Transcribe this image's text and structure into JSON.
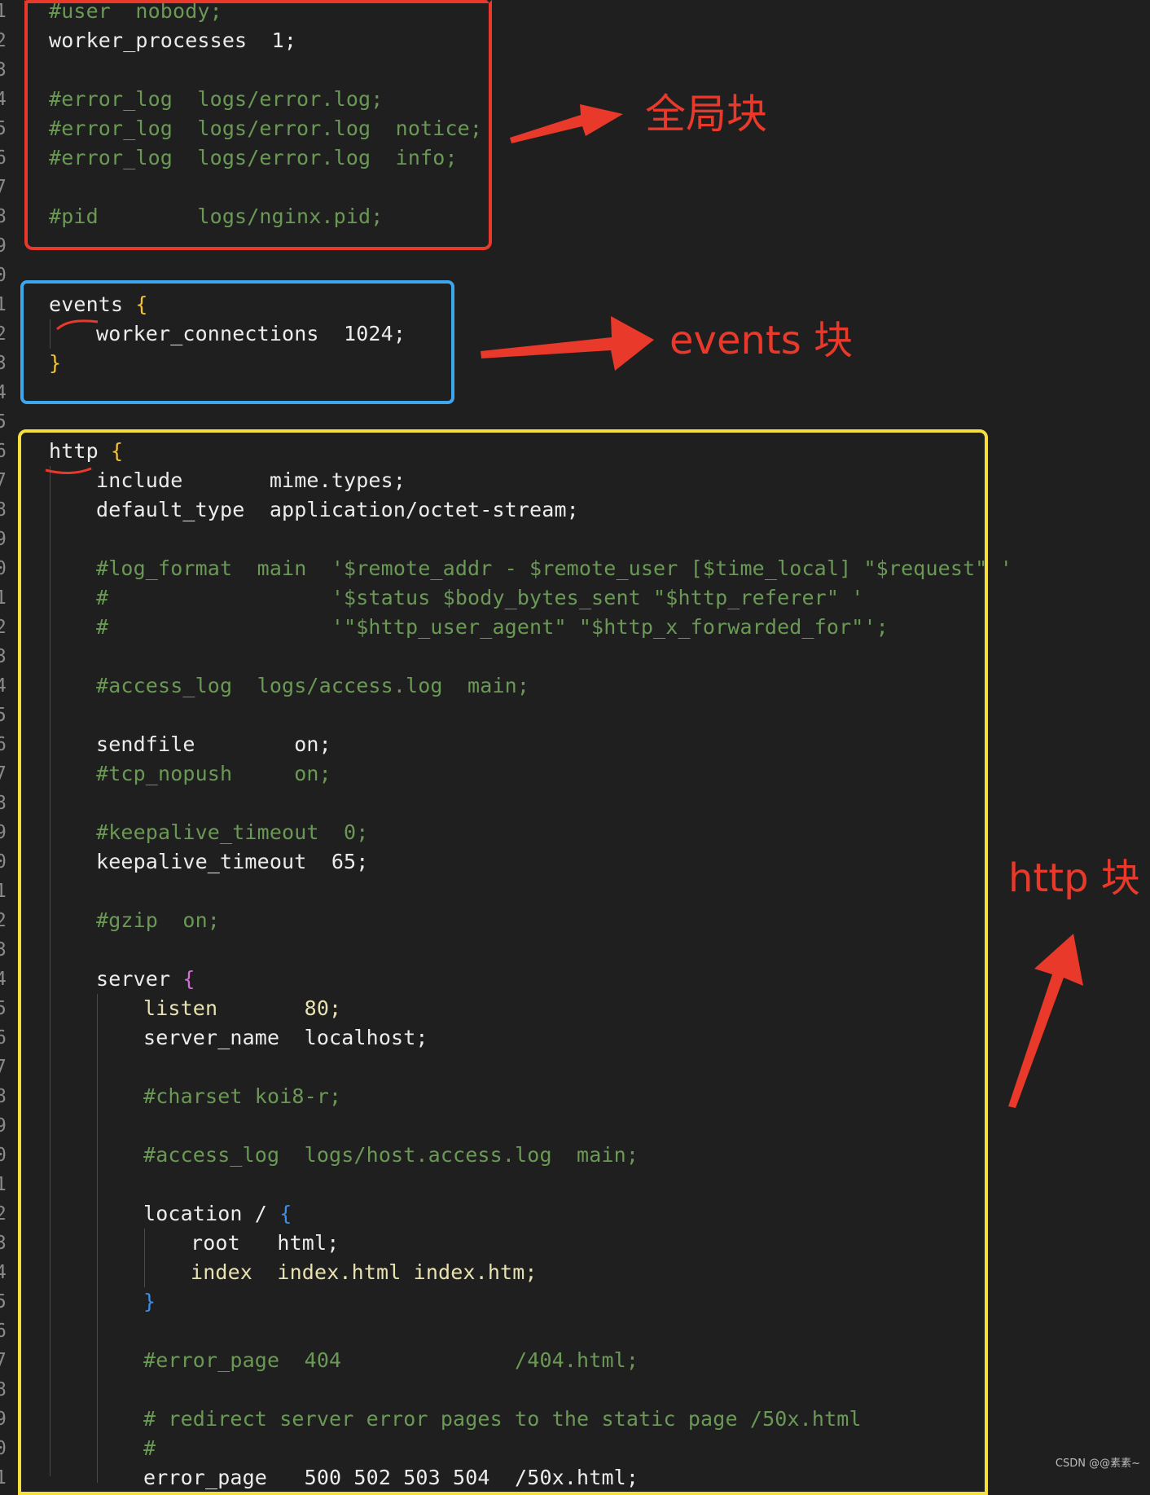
{
  "code_lines": [
    {
      "ln": "1",
      "text": "#user  nobody;",
      "style": "comment",
      "indent": 0
    },
    {
      "ln": "2",
      "text": "worker_processes  1;",
      "style": "plain",
      "indent": 0
    },
    {
      "ln": "3",
      "text": "",
      "style": "plain",
      "indent": 0
    },
    {
      "ln": "4",
      "text": "#error_log  logs/error.log;",
      "style": "comment",
      "indent": 0
    },
    {
      "ln": "5",
      "text": "#error_log  logs/error.log  notice;",
      "style": "comment",
      "indent": 0
    },
    {
      "ln": "6",
      "text": "#error_log  logs/error.log  info;",
      "style": "comment",
      "indent": 0
    },
    {
      "ln": "7",
      "text": "",
      "style": "plain",
      "indent": 0
    },
    {
      "ln": "8",
      "text": "#pid        logs/nginx.pid;",
      "style": "comment",
      "indent": 0
    },
    {
      "ln": "9",
      "text": "",
      "style": "plain",
      "indent": 0
    },
    {
      "ln": "0",
      "text": "",
      "style": "plain",
      "indent": 0
    },
    {
      "ln": "1",
      "text": "events ",
      "style": "plain",
      "indent": 0,
      "brace": "{",
      "brace_style": "brace-gold"
    },
    {
      "ln": "2",
      "text": "worker_connections  1024;",
      "style": "plain",
      "indent": 1
    },
    {
      "ln": "3",
      "text": "",
      "style": "plain",
      "indent": 0,
      "brace": "}",
      "brace_style": "brace-gold"
    },
    {
      "ln": "4",
      "text": "",
      "style": "plain",
      "indent": 0
    },
    {
      "ln": "5",
      "text": "",
      "style": "plain",
      "indent": 0
    },
    {
      "ln": "6",
      "text": "http ",
      "style": "plain",
      "indent": 0,
      "brace": "{",
      "brace_style": "brace-gold"
    },
    {
      "ln": "7",
      "text": "include       mime.types;",
      "style": "plain",
      "indent": 1
    },
    {
      "ln": "8",
      "text": "default_type  application/octet-stream;",
      "style": "plain",
      "indent": 1
    },
    {
      "ln": "9",
      "text": "",
      "style": "plain",
      "indent": 0
    },
    {
      "ln": "0",
      "text": "#log_format  main  '$remote_addr - $remote_user [$time_local] \"$request\" '",
      "style": "comment",
      "indent": 1
    },
    {
      "ln": "1",
      "text": "#                  '$status $body_bytes_sent \"$http_referer\" '",
      "style": "comment",
      "indent": 1
    },
    {
      "ln": "2",
      "text": "#                  '\"$http_user_agent\" \"$http_x_forwarded_for\"';",
      "style": "comment",
      "indent": 1
    },
    {
      "ln": "3",
      "text": "",
      "style": "plain",
      "indent": 0
    },
    {
      "ln": "4",
      "text": "#access_log  logs/access.log  main;",
      "style": "comment",
      "indent": 1
    },
    {
      "ln": "5",
      "text": "",
      "style": "plain",
      "indent": 0
    },
    {
      "ln": "6",
      "text": "sendfile        on;",
      "style": "plain",
      "indent": 1
    },
    {
      "ln": "7",
      "text": "#tcp_nopush     on;",
      "style": "comment",
      "indent": 1
    },
    {
      "ln": "8",
      "text": "",
      "style": "plain",
      "indent": 0
    },
    {
      "ln": "9",
      "text": "#keepalive_timeout  0;",
      "style": "comment",
      "indent": 1
    },
    {
      "ln": "0",
      "text": "keepalive_timeout  65;",
      "style": "plain",
      "indent": 1
    },
    {
      "ln": "1",
      "text": "",
      "style": "plain",
      "indent": 0
    },
    {
      "ln": "2",
      "text": "#gzip  on;",
      "style": "comment",
      "indent": 1
    },
    {
      "ln": "3",
      "text": "",
      "style": "plain",
      "indent": 0
    },
    {
      "ln": "4",
      "text": "server ",
      "style": "plain",
      "indent": 1,
      "brace": "{",
      "brace_style": "brace-purple"
    },
    {
      "ln": "5",
      "text": "listen       80;",
      "style": "keyword",
      "indent": 2
    },
    {
      "ln": "6",
      "text": "server_name  localhost;",
      "style": "plain",
      "indent": 2
    },
    {
      "ln": "7",
      "text": "",
      "style": "plain",
      "indent": 0
    },
    {
      "ln": "8",
      "text": "#charset koi8-r;",
      "style": "comment",
      "indent": 2
    },
    {
      "ln": "9",
      "text": "",
      "style": "plain",
      "indent": 0
    },
    {
      "ln": "0",
      "text": "#access_log  logs/host.access.log  main;",
      "style": "comment",
      "indent": 2
    },
    {
      "ln": "1",
      "text": "",
      "style": "plain",
      "indent": 0
    },
    {
      "ln": "2",
      "text": "location / ",
      "style": "plain",
      "indent": 2,
      "brace": "{",
      "brace_style": "brace-blue"
    },
    {
      "ln": "3",
      "text": "root   html;",
      "style": "plain",
      "indent": 3
    },
    {
      "ln": "4",
      "text": "index  index.html index.htm;",
      "style": "keyword",
      "indent": 3
    },
    {
      "ln": "5",
      "text": "",
      "style": "plain",
      "indent": 2,
      "brace": "}",
      "brace_style": "brace-blue"
    },
    {
      "ln": "6",
      "text": "",
      "style": "plain",
      "indent": 0
    },
    {
      "ln": "7",
      "text": "#error_page  404              /404.html;",
      "style": "comment",
      "indent": 2
    },
    {
      "ln": "8",
      "text": "",
      "style": "plain",
      "indent": 0
    },
    {
      "ln": "9",
      "text": "# redirect server error pages to the static page /50x.html",
      "style": "comment",
      "indent": 2
    },
    {
      "ln": "0",
      "text": "#",
      "style": "comment",
      "indent": 2
    },
    {
      "ln": "1",
      "text": "error_page   500 502 503 504  /50x.html;",
      "style": "plain",
      "indent": 2
    }
  ],
  "annotations": {
    "global_block": "全局块",
    "events_block": "events 块",
    "http_block": "http 块"
  },
  "colors": {
    "background": "#1f1f1f",
    "annotation_red": "#e8392b",
    "global_box": "#e8392b",
    "events_box": "#3ea6ee",
    "http_box": "#f6df3a"
  },
  "watermark": "CSDN @@素素~"
}
